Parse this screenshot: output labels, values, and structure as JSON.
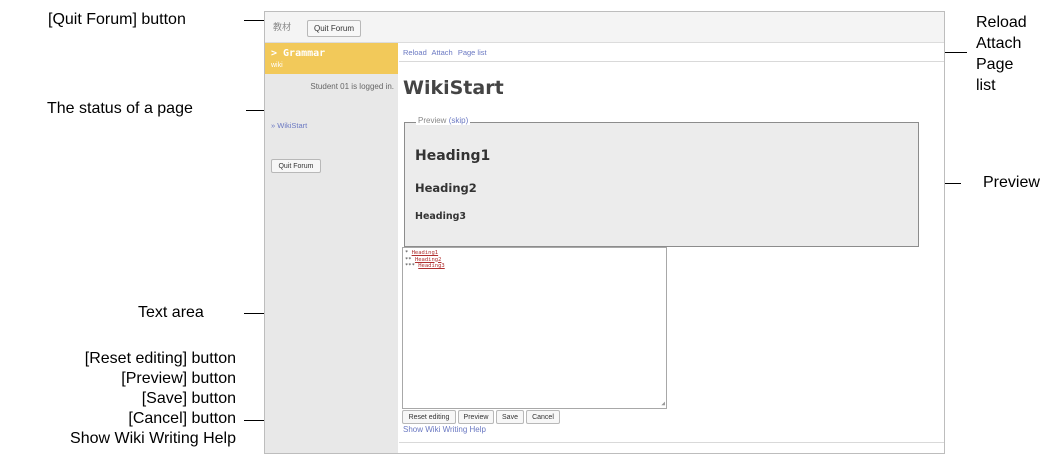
{
  "annotations": {
    "quit_forum": "[Quit Forum] button",
    "page_status": "The status of a page",
    "text_area": "Text area",
    "reload_lines": [
      "Reload",
      "Attach",
      "Page list"
    ],
    "preview": "Preview",
    "buttons_lines": [
      "[Reset editing] button",
      "[Preview] button",
      "[Save] button",
      "[Cancel] button",
      "Show Wiki Writing Help"
    ]
  },
  "app": {
    "top_label": "教材",
    "quit_forum_label": "Quit Forum",
    "accent_color": "#f2c95a",
    "link_color": "#6a78c2"
  },
  "sidebar": {
    "forum_title": "> Grammar",
    "forum_subtitle": "wiki",
    "logged_in": "Student 01 is logged in.",
    "page_link": "» WikiStart",
    "quit_forum_label": "Quit Forum"
  },
  "main": {
    "links": [
      "Reload",
      "Attach",
      "Page list"
    ],
    "page_title": "WikiStart",
    "preview_legend": "Preview",
    "preview_skip": "(skip)",
    "preview_heading1": "Heading1",
    "preview_heading2": "Heading2",
    "preview_heading3": "Heading3",
    "textarea_lines": [
      {
        "prefix": "* ",
        "text": "Heading1"
      },
      {
        "prefix": "** ",
        "text": "Heading2"
      },
      {
        "prefix": "*** ",
        "text": "Heading3"
      }
    ],
    "buttons": {
      "reset": "Reset editing",
      "preview": "Preview",
      "save": "Save",
      "cancel": "Cancel"
    },
    "help_link": "Show Wiki Writing Help"
  }
}
